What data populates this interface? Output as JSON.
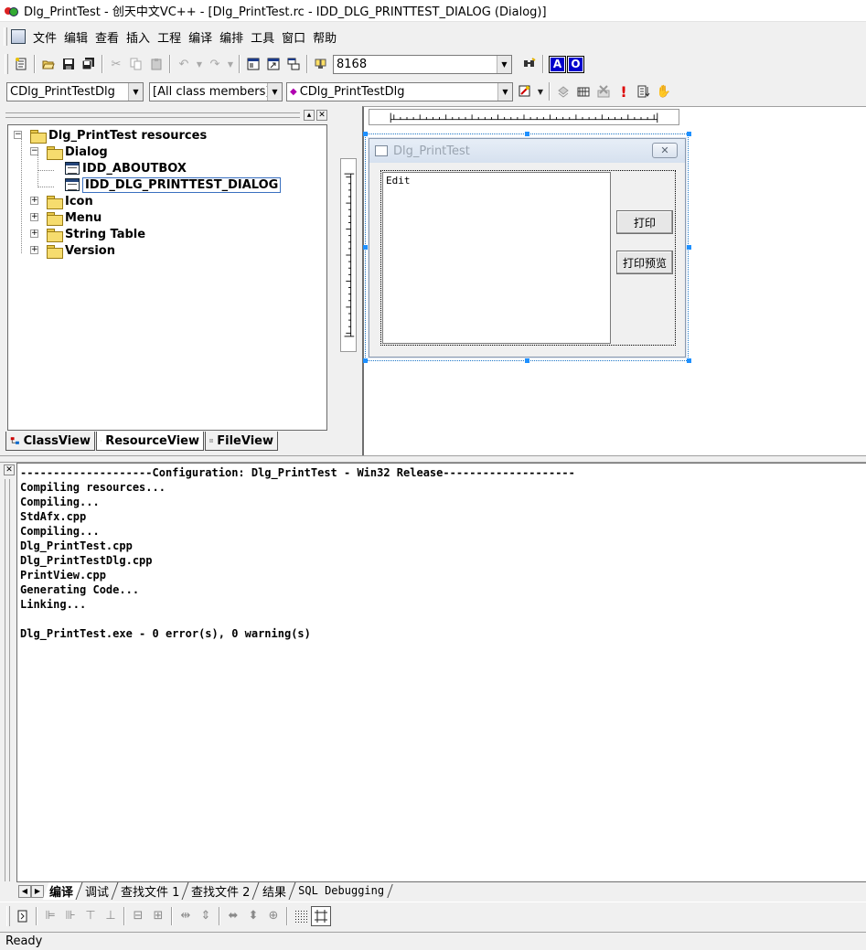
{
  "window": {
    "title": "Dlg_PrintTest - 创天中文VC++ - [Dlg_PrintTest.rc - IDD_DLG_PRINTTEST_DIALOG (Dialog)]"
  },
  "menu": {
    "items": [
      "文件",
      "编辑",
      "查看",
      "插入",
      "工程",
      "编译",
      "编排",
      "工具",
      "窗口",
      "帮助"
    ]
  },
  "toolbar": {
    "find_combo_value": "8168",
    "class_combo_value": "CDlg_PrintTestDlg",
    "filter_combo_value": "[All class members]",
    "member_combo_value": "CDlg_PrintTestDlg",
    "icon_a": "A",
    "icon_o": "O"
  },
  "workspace": {
    "tree": {
      "root": "Dlg_PrintTest resources",
      "dialog_folder": "Dialog",
      "dialog_items": [
        "IDD_ABOUTBOX",
        "IDD_DLG_PRINTTEST_DIALOG"
      ],
      "other_folders": [
        "Icon",
        "Menu",
        "String Table",
        "Version"
      ]
    },
    "tabs": [
      "ClassView",
      "ResourceView",
      "FileView"
    ],
    "active_tab": "ResourceView"
  },
  "dialog_preview": {
    "caption": "Dlg_PrintTest",
    "edit_text": "Edit",
    "print_button": "打印",
    "preview_button": "打印预览"
  },
  "output": {
    "lines": [
      "--------------------Configuration: Dlg_PrintTest - Win32 Release--------------------",
      "Compiling resources...",
      "Compiling...",
      "StdAfx.cpp",
      "Compiling...",
      "Dlg_PrintTest.cpp",
      "Dlg_PrintTestDlg.cpp",
      "PrintView.cpp",
      "Generating Code...",
      "Linking...",
      "",
      "Dlg_PrintTest.exe - 0 error(s), 0 warning(s)"
    ],
    "tabs": [
      "编译",
      "调试",
      "查找文件 1",
      "查找文件 2",
      "结果",
      "SQL Debugging"
    ],
    "active_tab": "编译"
  },
  "status": {
    "text": "Ready"
  }
}
